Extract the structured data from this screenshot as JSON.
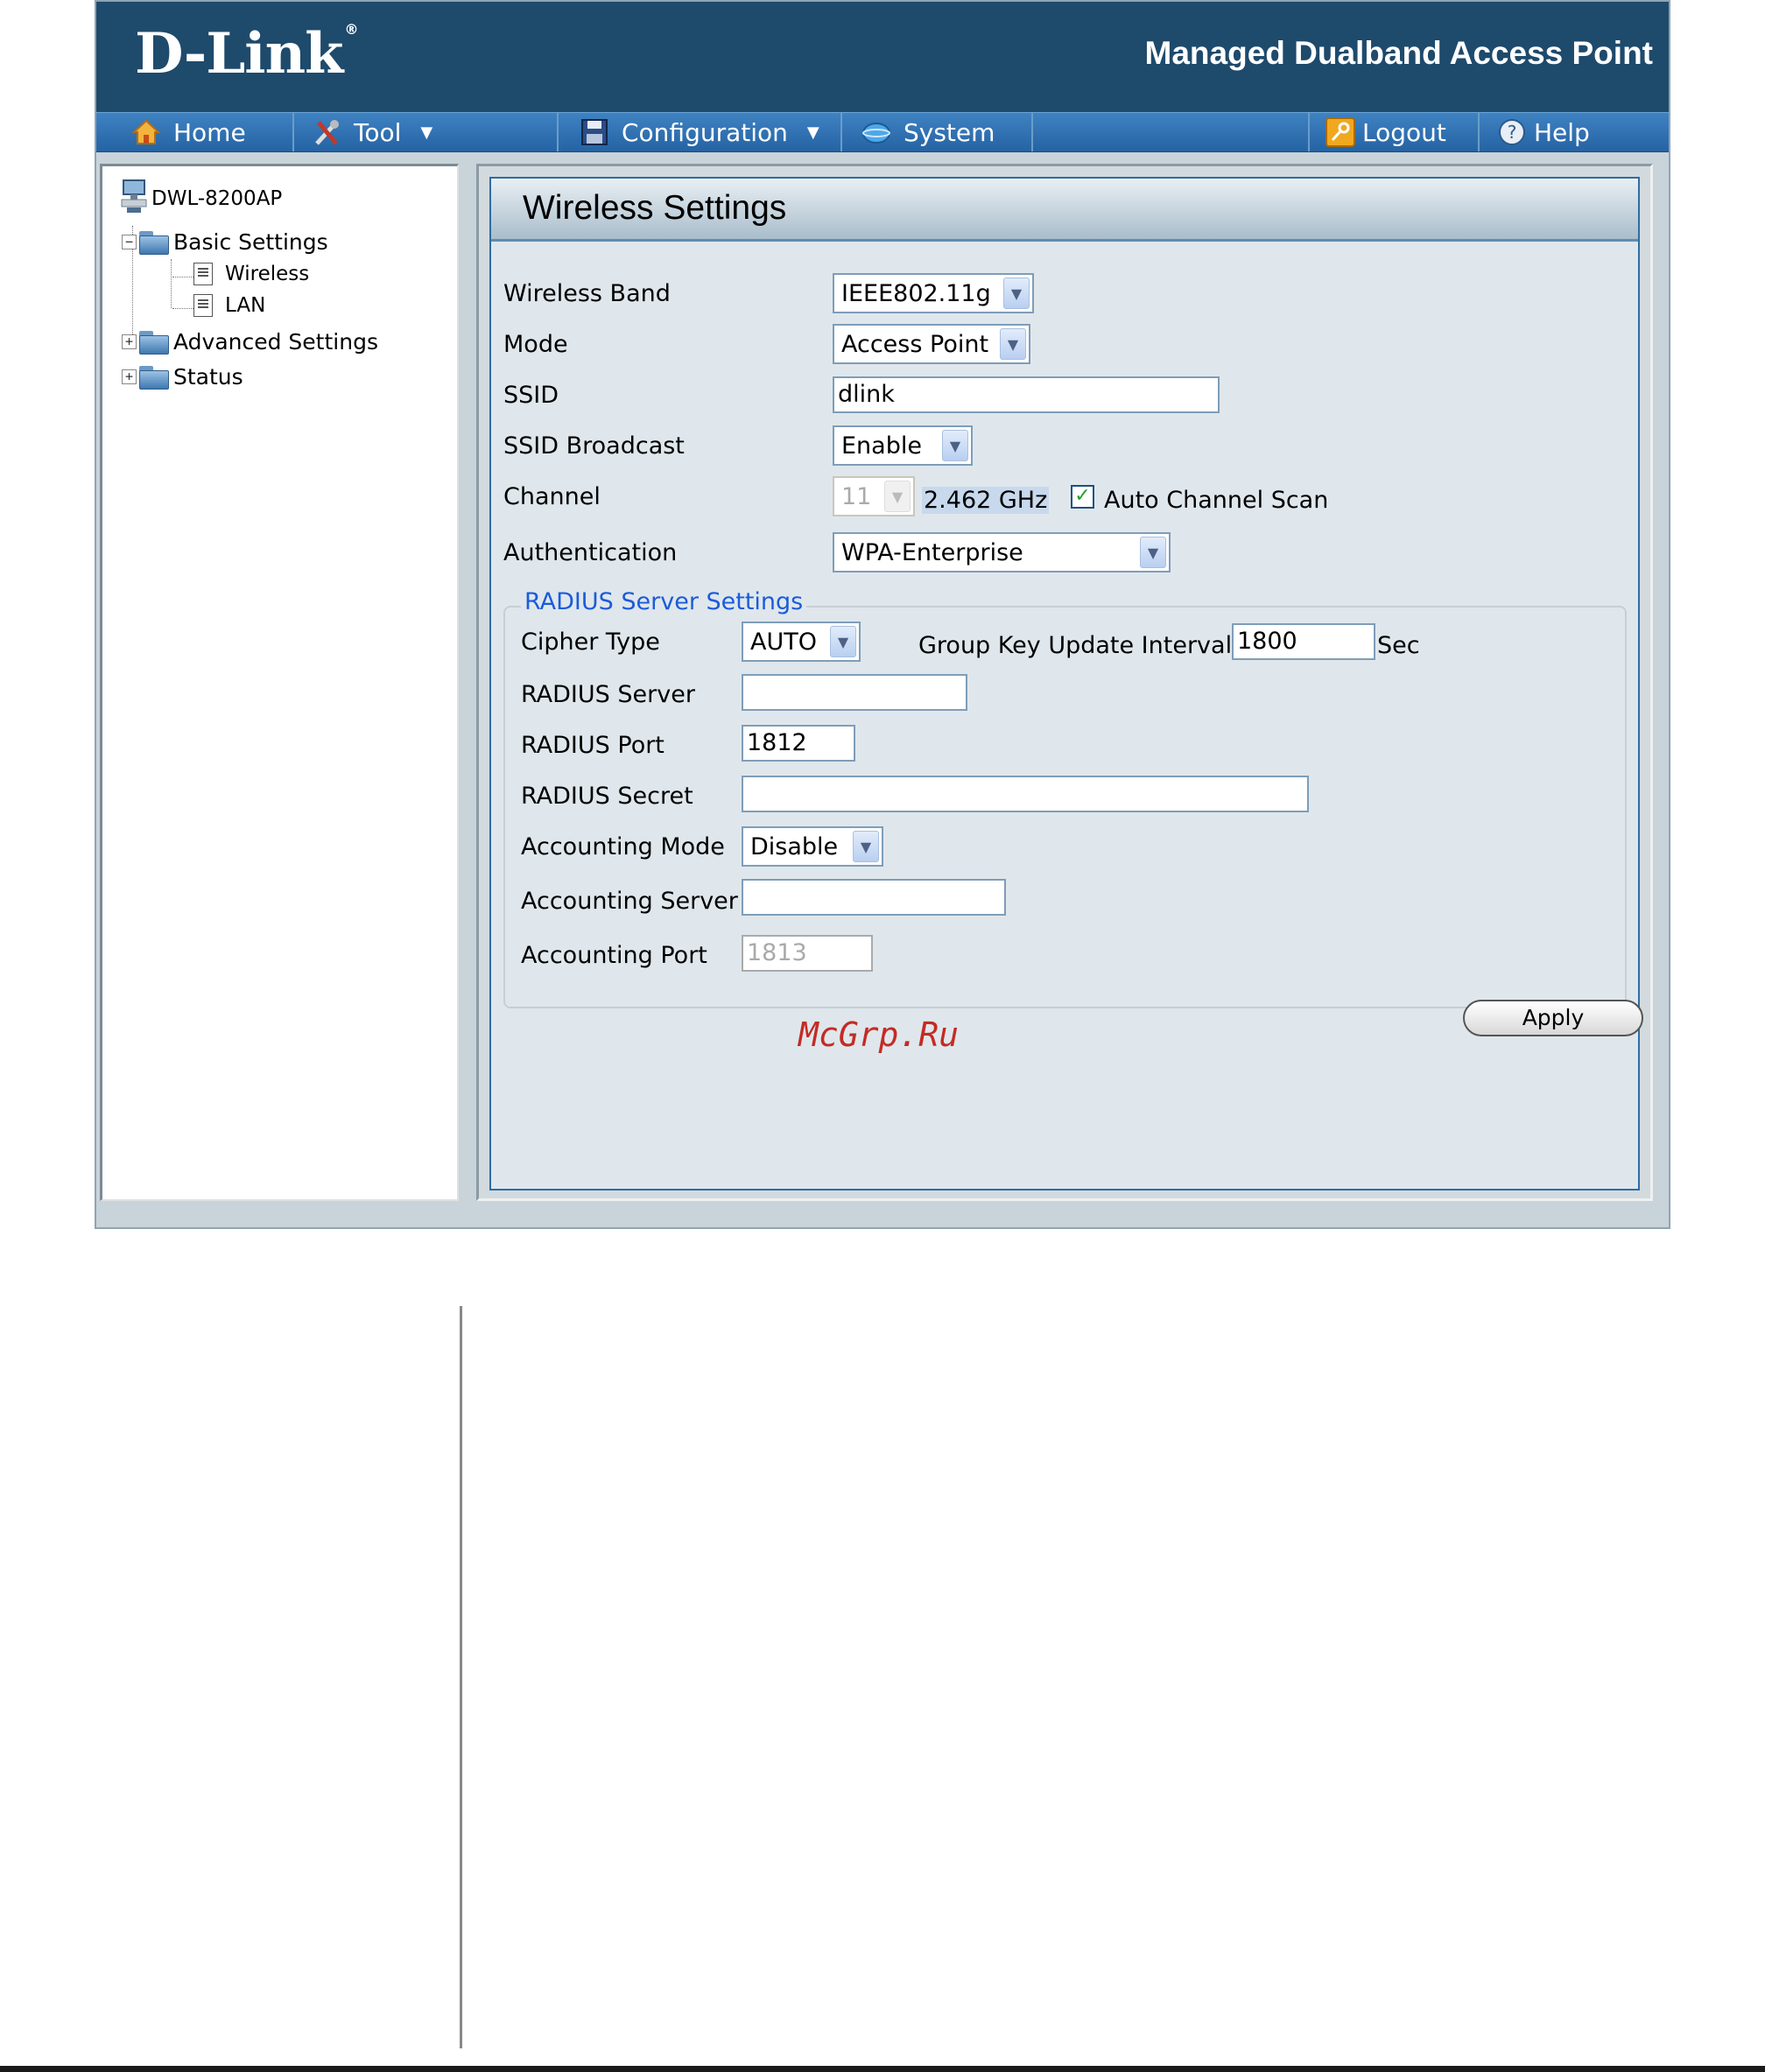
{
  "header": {
    "brand": "D-Link",
    "registered": "®",
    "product_title": "Managed Dualband Access Point"
  },
  "nav": {
    "home": "Home",
    "tool": "Tool",
    "configuration": "Configuration",
    "system": "System",
    "logout": "Logout",
    "help": "Help"
  },
  "tree": {
    "root": "DWL-8200AP",
    "basic_settings": "Basic Settings",
    "wireless": "Wireless",
    "lan": "LAN",
    "advanced_settings": "Advanced Settings",
    "status": "Status",
    "collapse_glyph": "−",
    "expand_glyph": "+"
  },
  "page": {
    "title": "Wireless Settings"
  },
  "form": {
    "wireless_band_label": "Wireless Band",
    "wireless_band_value": "IEEE802.11g",
    "mode_label": "Mode",
    "mode_value": "Access Point",
    "ssid_label": "SSID",
    "ssid_value": "dlink",
    "ssid_broadcast_label": "SSID Broadcast",
    "ssid_broadcast_value": "Enable",
    "channel_label": "Channel",
    "channel_value": "11",
    "frequency": "2.462 GHz",
    "auto_channel_scan_label": "Auto Channel Scan",
    "auto_channel_scan_checked": true,
    "check_glyph": "✓",
    "authentication_label": "Authentication",
    "authentication_value": "WPA-Enterprise"
  },
  "radius": {
    "legend": "RADIUS Server Settings",
    "cipher_type_label": "Cipher Type",
    "cipher_type_value": "AUTO",
    "group_key_label": "Group Key Update Interval",
    "group_key_value": "1800",
    "group_key_unit": "Sec",
    "radius_server_label": "RADIUS Server",
    "radius_server_value": "",
    "radius_port_label": "RADIUS Port",
    "radius_port_value": "1812",
    "radius_secret_label": "RADIUS Secret",
    "radius_secret_value": "",
    "accounting_mode_label": "Accounting Mode",
    "accounting_mode_value": "Disable",
    "accounting_server_label": "Accounting Server",
    "accounting_server_value": "",
    "accounting_port_label": "Accounting Port",
    "accounting_port_value": "1813"
  },
  "actions": {
    "apply": "Apply"
  },
  "watermark": "McGrp.Ru",
  "icons": {
    "home": "home-icon",
    "tool": "tool-icon",
    "configuration": "floppy-disk-icon",
    "system": "globe-icon",
    "logout": "key-icon",
    "help": "help-icon",
    "dropdown": "chevron-down-icon"
  },
  "colors": {
    "header_bg": "#1e4a6c",
    "nav_bg": "#2f73b5",
    "legend_text": "#1c5bd9",
    "check": "#21a121",
    "watermark": "#c42b25"
  }
}
